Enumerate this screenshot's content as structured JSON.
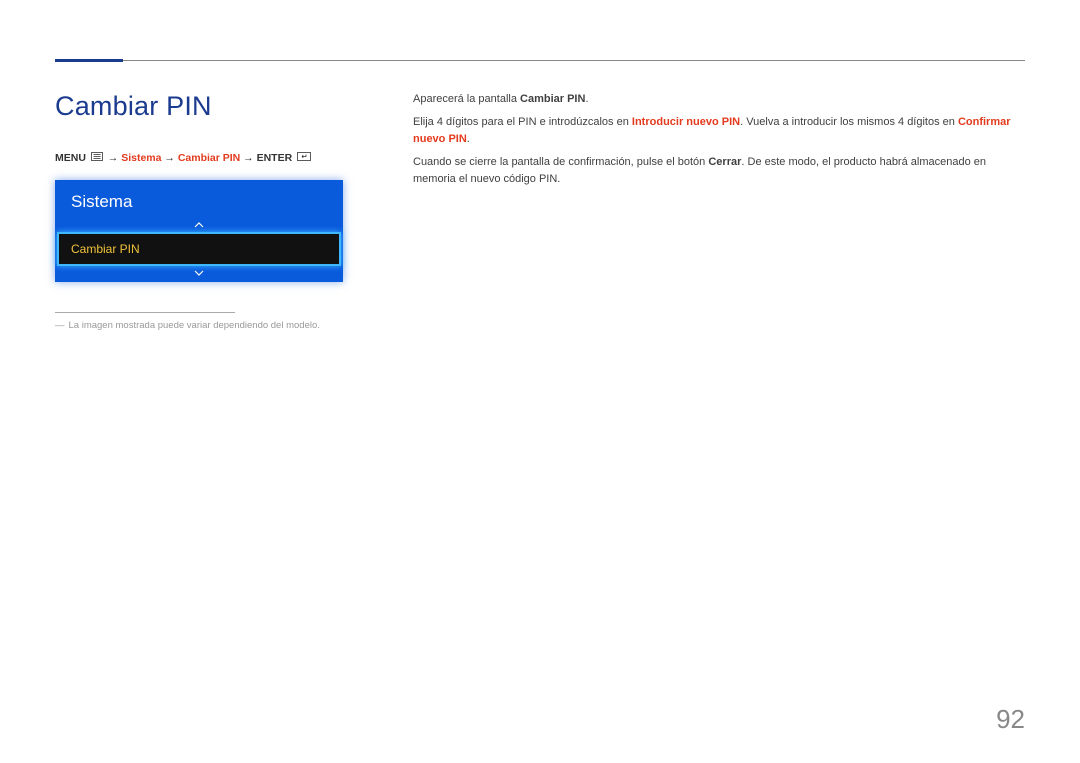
{
  "heading": "Cambiar PIN",
  "breadcrumb": {
    "menu": "MENU",
    "sep1": "→",
    "sistema": "Sistema",
    "sep2": "→",
    "cambiar": "Cambiar PIN",
    "sep3": "→",
    "enter": "ENTER"
  },
  "menuBox": {
    "title": "Sistema",
    "selected": "Cambiar PIN"
  },
  "footnote": {
    "dash": "―",
    "text": "La imagen mostrada puede variar dependiendo del modelo."
  },
  "right": {
    "p1a": "Aparecerá la pantalla ",
    "p1b": "Cambiar PIN",
    "p1c": ".",
    "p2a": "Elija 4 dígitos para el PIN e introdúzcalos en ",
    "p2b": "Introducir nuevo PIN",
    "p2c": ". Vuelva a introducir los mismos 4 dígitos en ",
    "p2d": "Confirmar nuevo PIN",
    "p2e": ".",
    "p3a": "Cuando se cierre la pantalla de confirmación, pulse el botón ",
    "p3b": "Cerrar",
    "p3c": ". De este modo, el producto habrá almacenado en memoria el nuevo código PIN."
  },
  "pageNumber": "92"
}
